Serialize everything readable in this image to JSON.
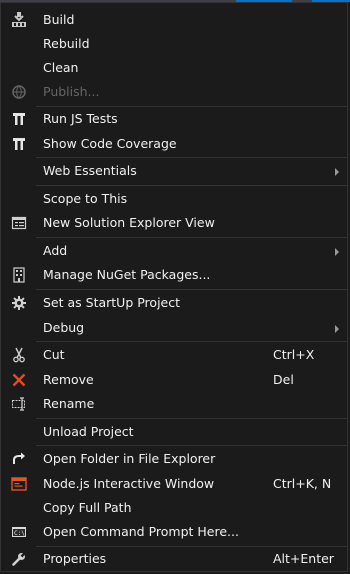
{
  "colors": {
    "background": "#1b1b1c",
    "text": "#f1f1f1",
    "disabled_text": "#656565",
    "separator": "#333337",
    "accent": "#0e70c0",
    "remove_icon": "#e8492a",
    "terminal_icon": "#e0562a"
  },
  "menu": {
    "items": [
      {
        "label": "Build",
        "icon": "build-icon"
      },
      {
        "label": "Rebuild",
        "icon": null
      },
      {
        "label": "Clean",
        "icon": null
      },
      {
        "label": "Publish...",
        "icon": "publish-globe-icon",
        "disabled": true
      },
      {
        "label": "Run JS Tests",
        "icon": "chutzpah-icon"
      },
      {
        "label": "Show Code Coverage",
        "icon": "chutzpah-icon"
      },
      {
        "label": "Web Essentials",
        "icon": null,
        "submenu": true
      },
      {
        "label": "Scope to This",
        "icon": null
      },
      {
        "label": "New Solution Explorer View",
        "icon": "solution-explorer-icon"
      },
      {
        "label": "Add",
        "icon": null,
        "submenu": true
      },
      {
        "label": "Manage NuGet Packages...",
        "icon": "nuget-icon"
      },
      {
        "label": "Set as StartUp Project",
        "icon": "gear-icon"
      },
      {
        "label": "Debug",
        "icon": null,
        "submenu": true
      },
      {
        "label": "Cut",
        "icon": "scissors-icon",
        "shortcut": "Ctrl+X"
      },
      {
        "label": "Remove",
        "icon": "remove-x-icon",
        "shortcut": "Del"
      },
      {
        "label": "Rename",
        "icon": "rename-icon"
      },
      {
        "label": "Unload Project",
        "icon": null
      },
      {
        "label": "Open Folder in File Explorer",
        "icon": "open-folder-arrow-icon"
      },
      {
        "label": "Node.js Interactive Window",
        "icon": "terminal-window-icon",
        "shortcut": "Ctrl+K, N"
      },
      {
        "label": "Copy Full Path",
        "icon": null
      },
      {
        "label": "Open Command Prompt Here...",
        "icon": "command-prompt-icon"
      },
      {
        "label": "Properties",
        "icon": "wrench-icon",
        "shortcut": "Alt+Enter"
      }
    ]
  }
}
